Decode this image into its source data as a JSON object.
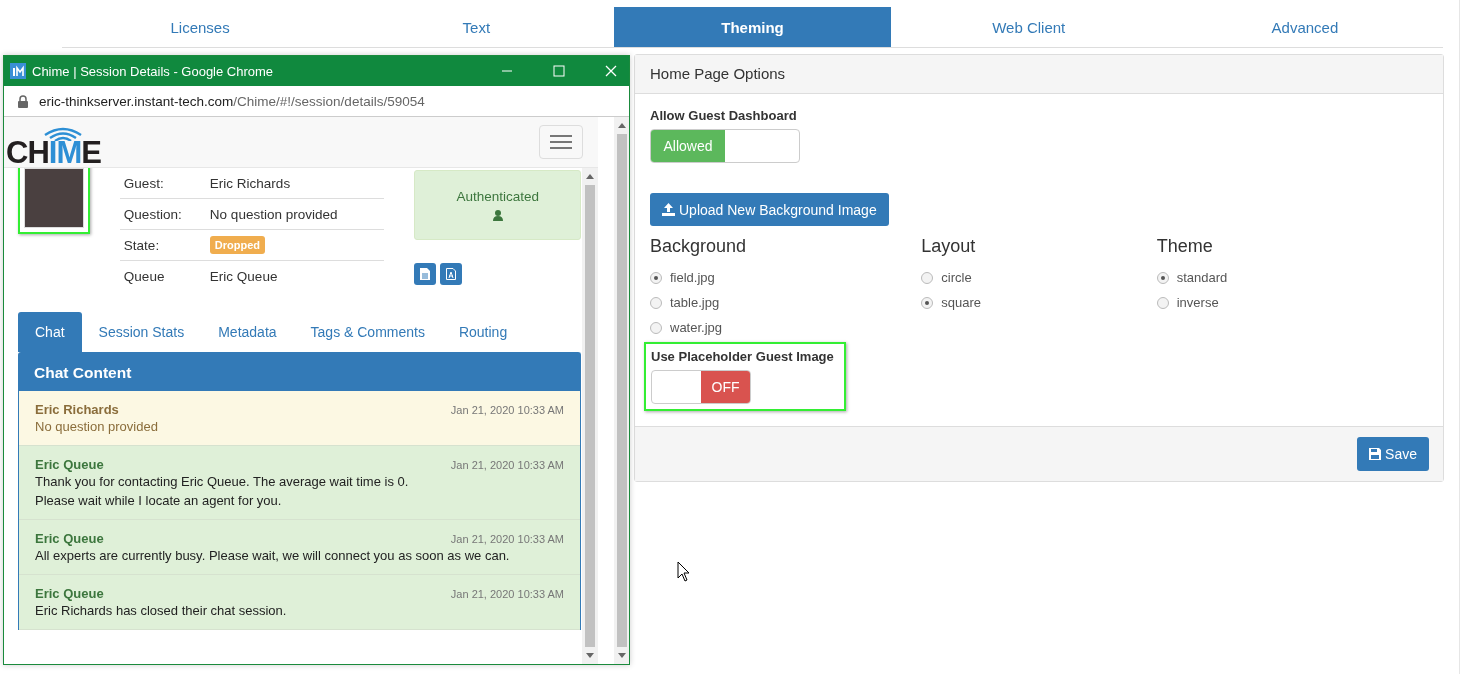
{
  "tabs": [
    {
      "label": "Licenses",
      "selected": false
    },
    {
      "label": "Text",
      "selected": false
    },
    {
      "label": "Theming",
      "selected": true
    },
    {
      "label": "Web Client",
      "selected": false
    },
    {
      "label": "Advanced",
      "selected": false
    }
  ],
  "panel": {
    "title": "Home Page Options",
    "guest_dashboard": {
      "label": "Allow Guest Dashboard",
      "switch_text": "Allowed",
      "on": true
    },
    "upload_button": "Upload New Background Image",
    "groups": [
      {
        "title": "Background",
        "options": [
          {
            "label": "field.jpg",
            "selected": true
          },
          {
            "label": "table.jpg",
            "selected": false
          },
          {
            "label": "water.jpg",
            "selected": false
          }
        ]
      },
      {
        "title": "Layout",
        "options": [
          {
            "label": "circle",
            "selected": false
          },
          {
            "label": "square",
            "selected": true
          }
        ]
      },
      {
        "title": "Theme",
        "options": [
          {
            "label": "standard",
            "selected": true
          },
          {
            "label": "inverse",
            "selected": false
          }
        ]
      }
    ],
    "placeholder_image": {
      "label": "Use Placeholder Guest Image",
      "switch_text": "OFF",
      "on": false,
      "highlighted": true
    },
    "save_button": "Save"
  },
  "popup": {
    "title": "Chime | Session Details - Google Chrome",
    "url_host": "eric-thinkserver.instant-tech.com",
    "url_path": "/Chime/#!/session/details/59054",
    "logo": [
      {
        "text": "CH",
        "accent": false
      },
      {
        "text": "IM",
        "accent": true
      },
      {
        "text": "E",
        "accent": false
      }
    ],
    "avatar": {
      "highlighted": true
    },
    "details": [
      {
        "label": "Guest:",
        "value": "Eric Richards",
        "kind": "text"
      },
      {
        "label": "Question:",
        "value": "No question provided",
        "kind": "text"
      },
      {
        "label": "State:",
        "value": "Dropped",
        "kind": "badge"
      },
      {
        "label": "Queue",
        "value": "Eric Queue",
        "kind": "text"
      }
    ],
    "status": "Authenticated",
    "tabs": [
      {
        "label": "Chat",
        "selected": true
      },
      {
        "label": "Session Stats",
        "selected": false
      },
      {
        "label": "Metadata",
        "selected": false
      },
      {
        "label": "Tags & Comments",
        "selected": false
      },
      {
        "label": "Routing",
        "selected": false
      }
    ],
    "chat_title": "Chat Content",
    "messages": [
      {
        "kind": "question",
        "sender": "Eric Richards",
        "time": "Jan 21, 2020 10:33 AM",
        "lines": [
          "No question provided"
        ]
      },
      {
        "kind": "system",
        "sender": "Eric Queue",
        "time": "Jan 21, 2020 10:33 AM",
        "lines": [
          "Thank you for contacting Eric Queue. The average wait time is 0.",
          "Please wait while I locate an agent for you."
        ]
      },
      {
        "kind": "system",
        "sender": "Eric Queue",
        "time": "Jan 21, 2020 10:33 AM",
        "lines": [
          "All experts are currently busy. Please wait, we will connect you as soon as we can."
        ]
      },
      {
        "kind": "system",
        "sender": "Eric Queue",
        "time": "Jan 21, 2020 10:33 AM",
        "lines": [
          "Eric Richards has closed their chat session."
        ]
      }
    ]
  }
}
